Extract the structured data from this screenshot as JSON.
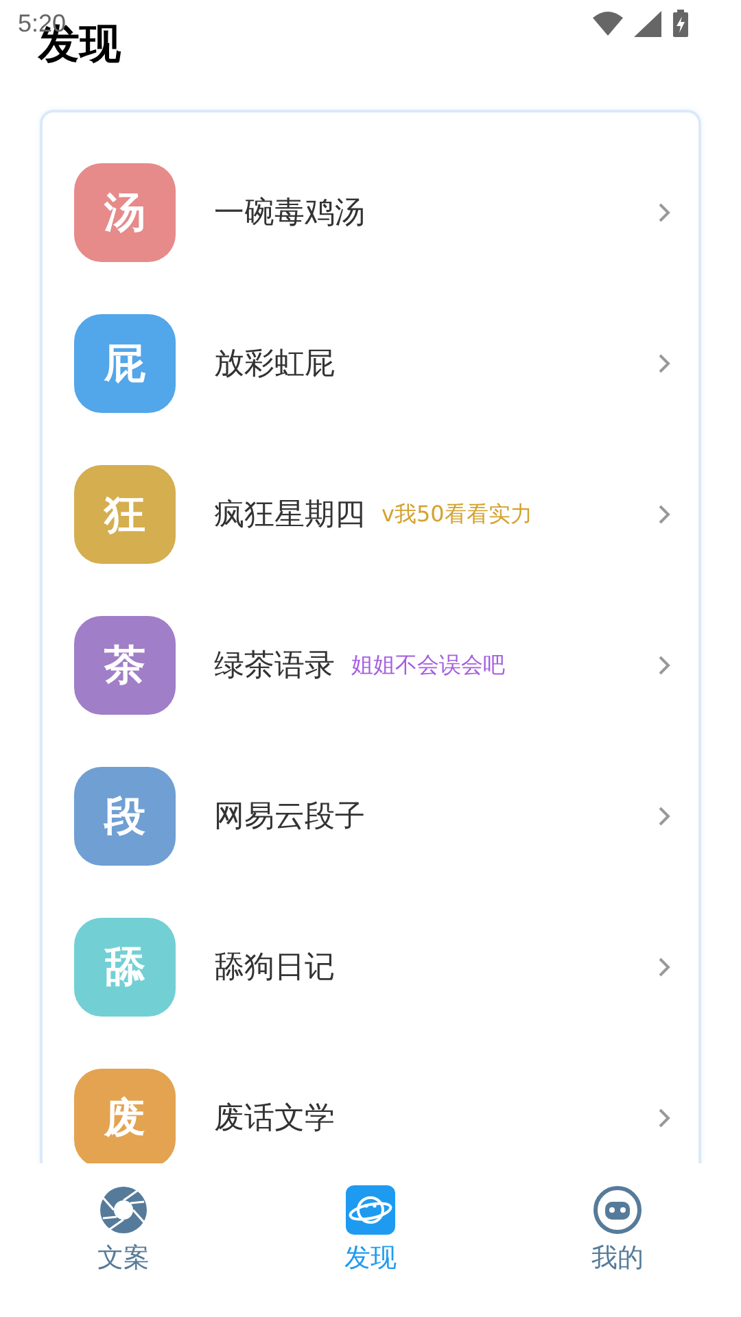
{
  "status_bar": {
    "time": "5:20"
  },
  "title": "发现",
  "items": [
    {
      "badge": "汤",
      "color": "#e68a8a",
      "label": "一碗毒鸡汤"
    },
    {
      "badge": "屁",
      "color": "#52a6ea",
      "label": "放彩虹屁"
    },
    {
      "badge": "狂",
      "color": "#d4ae4f",
      "label": "疯狂星期四",
      "tag": {
        "text": "v我50看看实力",
        "color": "#d4a22e"
      }
    },
    {
      "badge": "茶",
      "color": "#a07ec8",
      "label": "绿茶语录",
      "tag": {
        "text": "姐姐不会误会吧",
        "color": "#a45fe0"
      }
    },
    {
      "badge": "段",
      "color": "#6f9fd3",
      "label": "网易云段子"
    },
    {
      "badge": "舔",
      "color": "#72d0d4",
      "label": "舔狗日记"
    },
    {
      "badge": "废",
      "color": "#e3a350",
      "label": "废话文学"
    }
  ],
  "nav": [
    {
      "kind": "aperture",
      "label": "文案",
      "selected": false
    },
    {
      "kind": "planet",
      "label": "发现",
      "selected": true
    },
    {
      "kind": "robot",
      "label": "我的",
      "selected": false
    }
  ]
}
